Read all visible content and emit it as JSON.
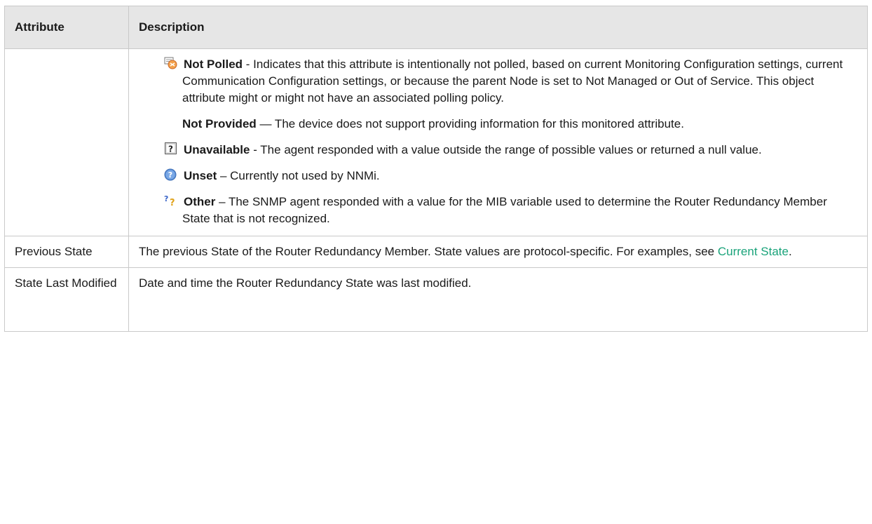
{
  "table": {
    "headers": {
      "attribute": "Attribute",
      "description": "Description"
    },
    "status_items": [
      {
        "icon": "not-polled-icon",
        "label": "Not Polled",
        "text": " - Indicates that this attribute is intentionally not polled, based on current Monitoring Configuration settings, current Communication Configuration settings, or because the parent Node is set to Not Managed or Out of Service. This object attribute might or might not have an associated polling policy."
      },
      {
        "icon": "",
        "label": "Not Provided",
        "text": " — The device does not support providing information for this monitored attribute."
      },
      {
        "icon": "unavailable-icon",
        "label": "Unavailable",
        "text": " - The agent responded with a value outside the range of possible values or returned a null value."
      },
      {
        "icon": "unset-icon",
        "label": "Unset",
        "text": " – Currently not used by NNMi."
      },
      {
        "icon": "other-icon",
        "label": "Other",
        "text": " – The SNMP agent responded with a value for the MIB variable used to determine the Router Redundancy Member State that is not recognized."
      }
    ],
    "rows": [
      {
        "attribute": "Previous State",
        "description": "The previous State of the Router Redundancy Member. State values are protocol-specific. For examples, see ",
        "link": "Current State",
        "after": "."
      },
      {
        "attribute": "State Last Modified",
        "description": "Date and time the Router Redundancy State was last modified."
      }
    ]
  }
}
